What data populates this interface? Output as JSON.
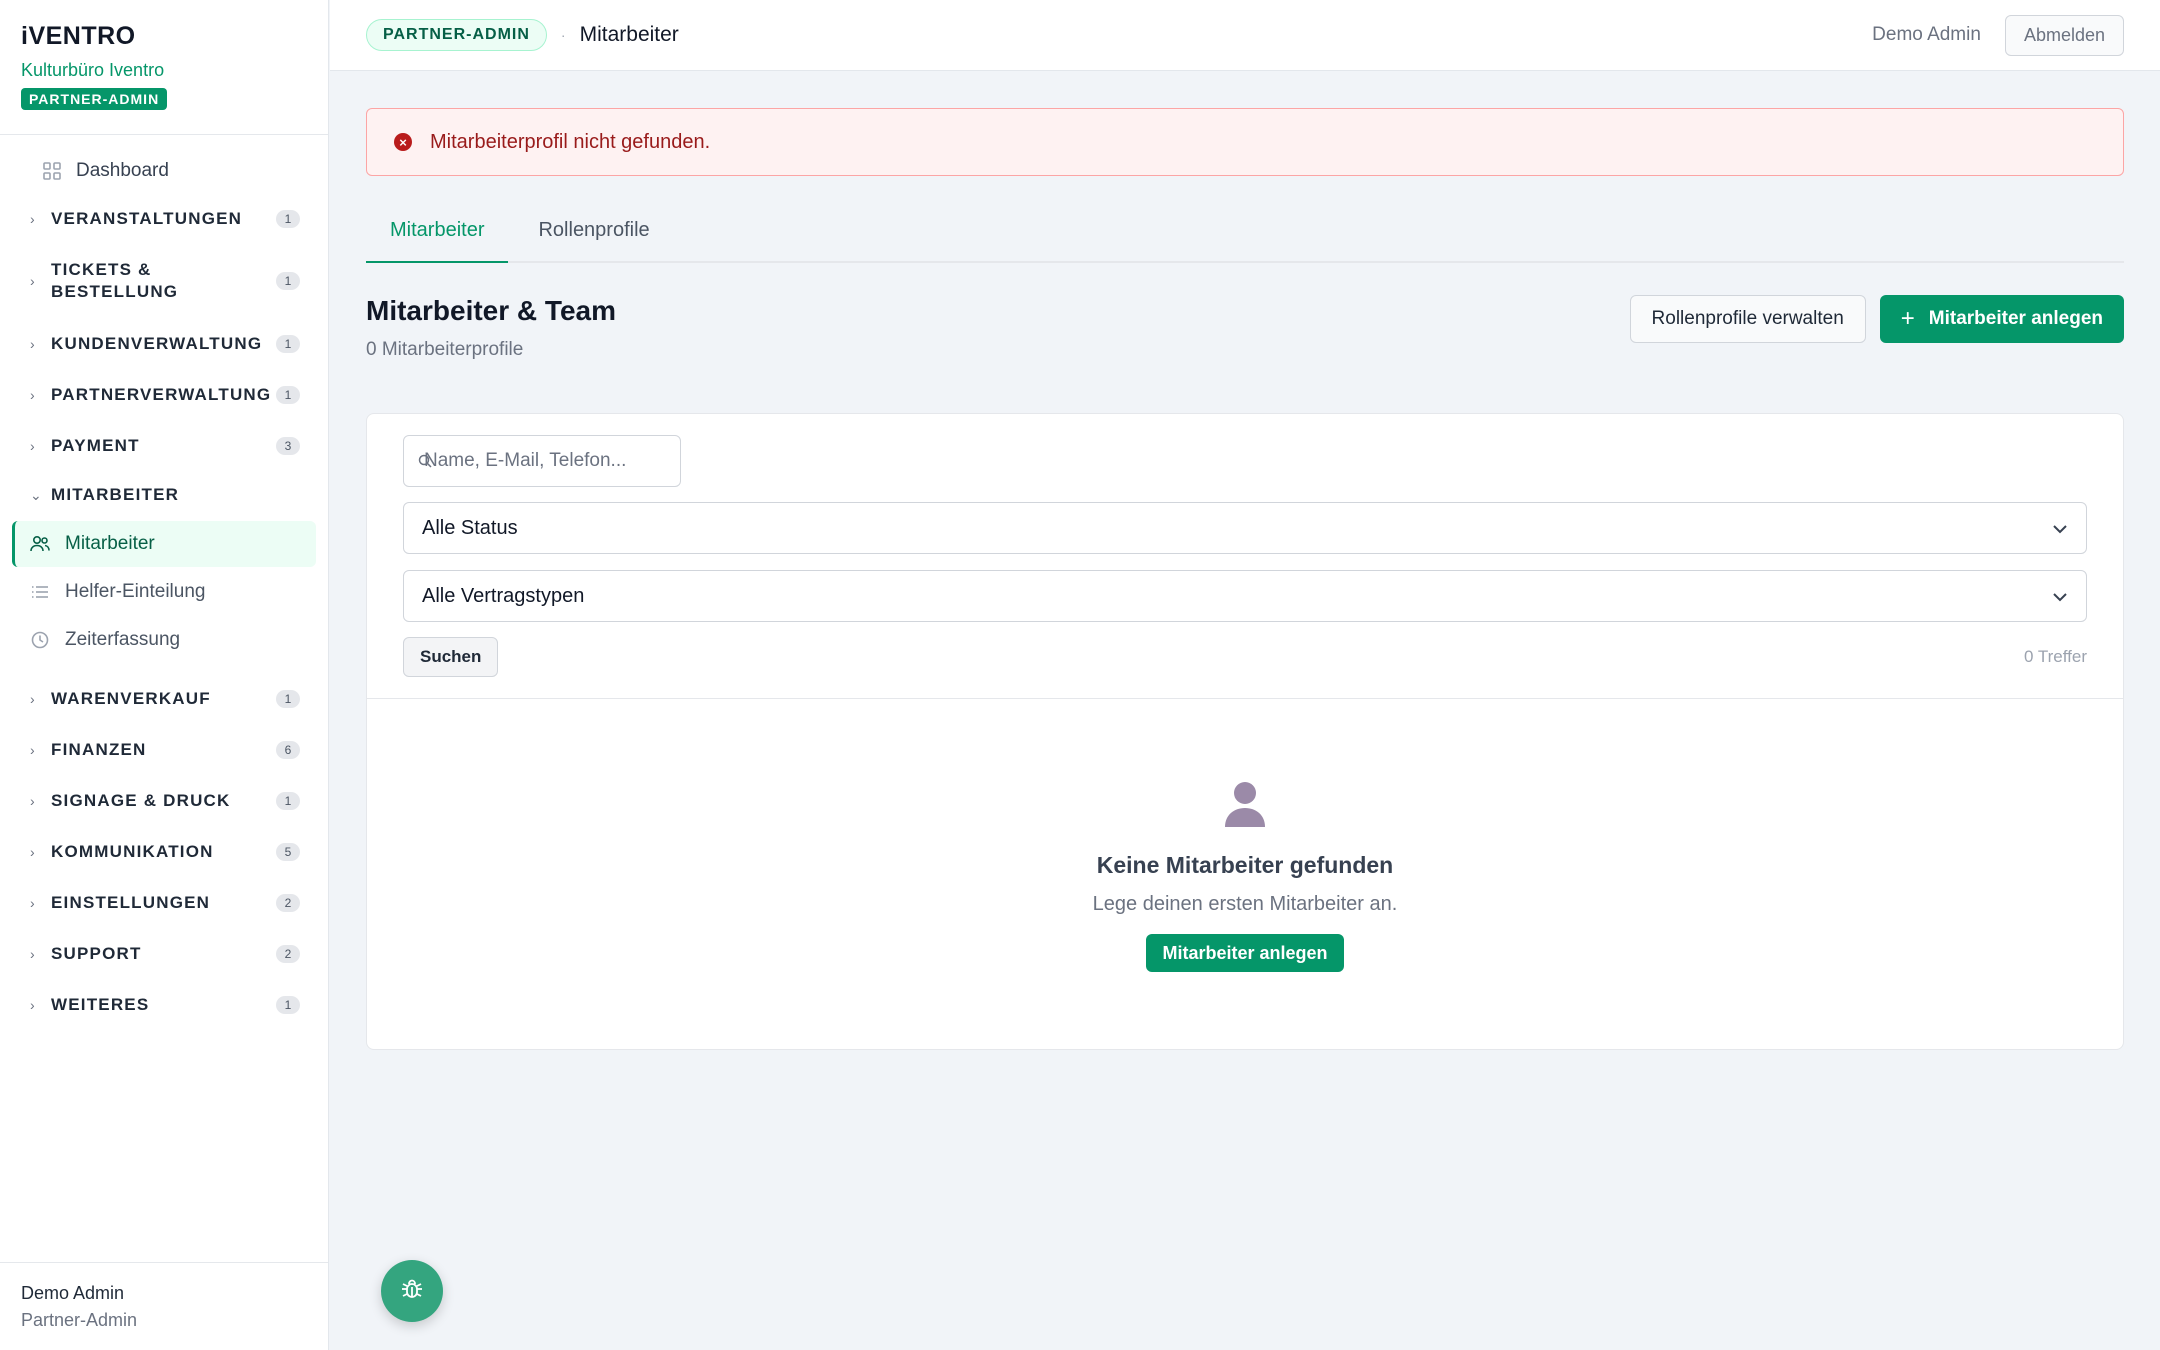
{
  "brand": {
    "logo": "iVENTRO",
    "org": "Kulturbüro Iventro",
    "badge": "PARTNER-ADMIN"
  },
  "nav": {
    "dashboard": "Dashboard",
    "groups_top": [
      {
        "label": "VERANSTALTUNGEN",
        "count": "1"
      },
      {
        "label": "TICKETS & BESTELLUNG",
        "count": "1"
      },
      {
        "label": "KUNDENVERWALTUNG",
        "count": "1"
      },
      {
        "label": "PARTNERVERWALTUNG",
        "count": "1"
      },
      {
        "label": "PAYMENT",
        "count": "3"
      }
    ],
    "mitarbeiter_group": "MITARBEITER",
    "mitarbeiter_items": [
      {
        "label": "Mitarbeiter",
        "icon": "users-icon"
      },
      {
        "label": "Helfer-Einteilung",
        "icon": "list-icon"
      },
      {
        "label": "Zeiterfassung",
        "icon": "clock-icon"
      }
    ],
    "groups_bottom": [
      {
        "label": "WARENVERKAUF",
        "count": "1"
      },
      {
        "label": "FINANZEN",
        "count": "6"
      },
      {
        "label": "SIGNAGE & DRUCK",
        "count": "1"
      },
      {
        "label": "KOMMUNIKATION",
        "count": "5"
      },
      {
        "label": "EINSTELLUNGEN",
        "count": "2"
      },
      {
        "label": "SUPPORT",
        "count": "2"
      },
      {
        "label": "WEITERES",
        "count": "1"
      }
    ]
  },
  "sidebar_footer": {
    "name": "Demo Admin",
    "role": "Partner-Admin"
  },
  "topbar": {
    "badge": "PARTNER-ADMIN",
    "separator": "·",
    "title": "Mitarbeiter",
    "user": "Demo Admin",
    "logout": "Abmelden"
  },
  "alert": {
    "message": "Mitarbeiterprofil nicht gefunden."
  },
  "tabs": [
    "Mitarbeiter",
    "Rollenprofile"
  ],
  "header": {
    "title": "Mitarbeiter & Team",
    "subtitle": "0 Mitarbeiterprofile",
    "manage_roles": "Rollenprofile verwalten",
    "add_employee": "Mitarbeiter anlegen"
  },
  "filters": {
    "search_placeholder": "Name, E-Mail, Telefon...",
    "status": "Alle Status",
    "contract": "Alle Vertragstypen",
    "search_button": "Suchen",
    "hits": "0 Treffer"
  },
  "empty": {
    "title": "Keine Mitarbeiter gefunden",
    "text": "Lege deinen ersten Mitarbeiter an.",
    "button": "Mitarbeiter anlegen"
  },
  "colors": {
    "accent": "#059669",
    "alert_bg": "#fef2f2",
    "alert_text": "#991b1b"
  }
}
